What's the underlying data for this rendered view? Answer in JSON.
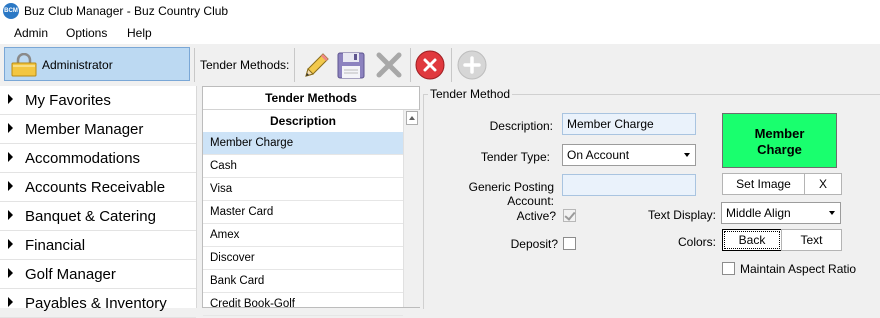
{
  "window": {
    "title": "Buz Club Manager - Buz Country Club",
    "app_icon_text": "BCM"
  },
  "menu": [
    "Admin",
    "Options",
    "Help"
  ],
  "toolbar": {
    "user": "Administrator",
    "section_label": "Tender Methods:",
    "buttons": [
      {
        "name": "edit",
        "icon": "pencil-icon"
      },
      {
        "name": "save",
        "icon": "floppy-disk-icon"
      },
      {
        "name": "delete",
        "icon": "x-icon"
      },
      {
        "name": "cancel",
        "icon": "red-circle-x-icon"
      },
      {
        "name": "add",
        "icon": "plus-circle-icon"
      }
    ]
  },
  "sidebar": {
    "items": [
      "My Favorites",
      "Member Manager",
      "Accommodations",
      "Accounts Receivable",
      "Banquet & Catering",
      "Financial",
      "Golf Manager",
      "Payables & Inventory"
    ]
  },
  "grid": {
    "title": "Tender Methods",
    "column": "Description",
    "rows": [
      "Member Charge",
      "Cash",
      "Visa",
      "Master Card",
      "Amex",
      "Discover",
      "Bank Card",
      "Credit Book-Golf"
    ],
    "selected_index": 0
  },
  "form": {
    "group_title": "Tender Method",
    "description_label": "Description:",
    "description_value": "Member Charge",
    "tender_type_label": "Tender Type:",
    "tender_type_value": "On Account",
    "generic_posting_label": "Generic Posting Account:",
    "generic_posting_value": "",
    "active_label": "Active?",
    "active_checked": true,
    "deposit_label": "Deposit?",
    "deposit_checked": false,
    "preview_text_line1": "Member",
    "preview_text_line2": "Charge",
    "preview_bg_color": "#19ff6e",
    "set_image_label": "Set Image",
    "clear_image_label": "X",
    "text_display_label": "Text Display:",
    "text_display_value": "Middle Align",
    "colors_label": "Colors:",
    "back_label": "Back",
    "text_label": "Text",
    "maintain_aspect_label": "Maintain Aspect Ratio",
    "maintain_aspect_checked": false
  }
}
